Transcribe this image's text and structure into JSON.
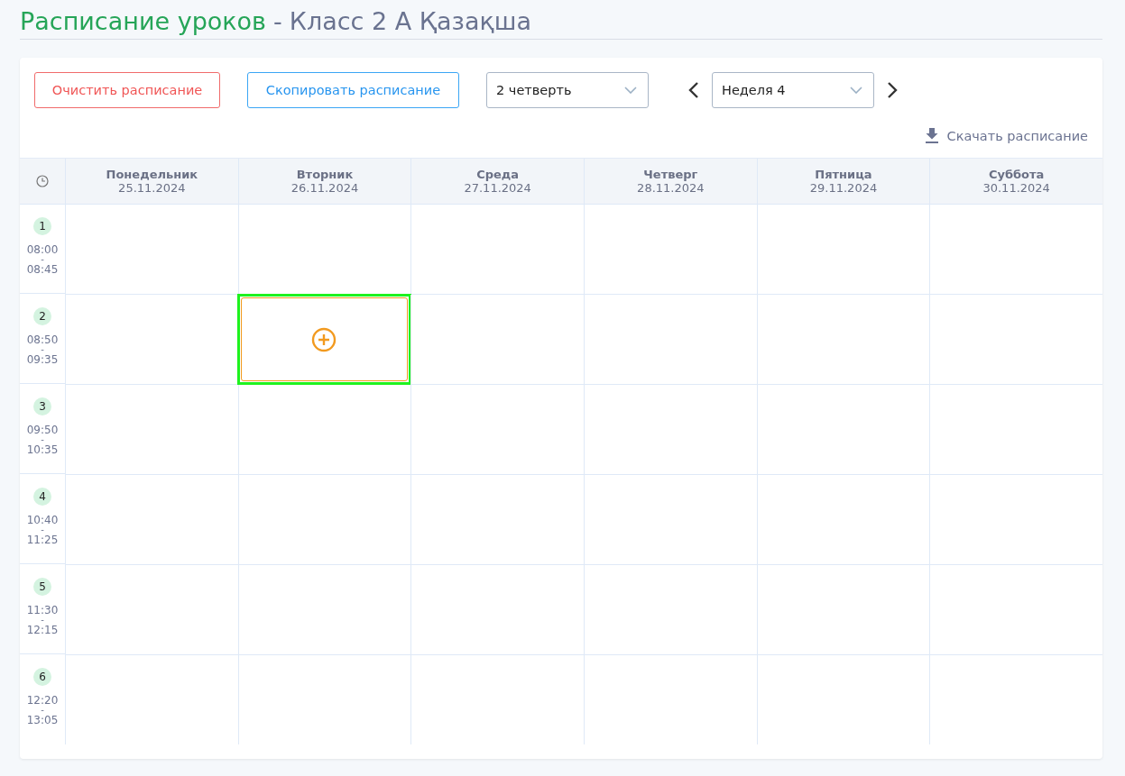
{
  "title": {
    "main": "Расписание уроков",
    "separator": "-",
    "class": "Класс 2 А Қазақша"
  },
  "toolbar": {
    "clear_button": "Очистить расписание",
    "copy_button": "Скопировать расписание",
    "quarter_select": {
      "value": "2 четверть"
    },
    "week_select": {
      "value": "Неделя 4"
    }
  },
  "download_link": "Скачать расписание",
  "days": [
    {
      "name": "Понедельник",
      "date": "25.11.2024"
    },
    {
      "name": "Вторник",
      "date": "26.11.2024"
    },
    {
      "name": "Среда",
      "date": "27.11.2024"
    },
    {
      "name": "Четверг",
      "date": "28.11.2024"
    },
    {
      "name": "Пятница",
      "date": "29.11.2024"
    },
    {
      "name": "Суббота",
      "date": "30.11.2024"
    }
  ],
  "lessons": [
    {
      "number": "1",
      "start": "08:00",
      "dash": "-",
      "end": "08:45",
      "cells": [
        {
          "kind": "empty"
        },
        {
          "kind": "empty"
        },
        {
          "kind": "empty"
        },
        {
          "kind": "empty"
        },
        {
          "kind": "empty"
        },
        {
          "kind": "empty"
        }
      ]
    },
    {
      "number": "2",
      "start": "08:50",
      "dash": "-",
      "end": "09:35",
      "cells": [
        {
          "kind": "empty"
        },
        {
          "kind": "add",
          "focused": true
        },
        {
          "kind": "empty"
        },
        {
          "kind": "empty"
        },
        {
          "kind": "empty"
        },
        {
          "kind": "empty"
        }
      ]
    },
    {
      "number": "3",
      "start": "09:50",
      "dash": "-",
      "end": "10:35",
      "cells": [
        {
          "kind": "empty"
        },
        {
          "kind": "empty"
        },
        {
          "kind": "empty"
        },
        {
          "kind": "empty"
        },
        {
          "kind": "empty"
        },
        {
          "kind": "empty"
        }
      ]
    },
    {
      "number": "4",
      "start": "10:40",
      "dash": "-",
      "end": "11:25",
      "cells": [
        {
          "kind": "empty"
        },
        {
          "kind": "empty"
        },
        {
          "kind": "empty"
        },
        {
          "kind": "empty"
        },
        {
          "kind": "empty"
        },
        {
          "kind": "empty"
        }
      ]
    },
    {
      "number": "5",
      "start": "11:30",
      "dash": "-",
      "end": "12:15",
      "cells": [
        {
          "kind": "empty"
        },
        {
          "kind": "empty"
        },
        {
          "kind": "empty"
        },
        {
          "kind": "empty"
        },
        {
          "kind": "empty"
        },
        {
          "kind": "empty"
        }
      ]
    },
    {
      "number": "6",
      "start": "12:20",
      "dash": "-",
      "end": "13:05",
      "cells": [
        {
          "kind": "empty"
        },
        {
          "kind": "empty"
        },
        {
          "kind": "empty"
        },
        {
          "kind": "empty"
        },
        {
          "kind": "empty"
        },
        {
          "kind": "empty"
        }
      ]
    }
  ]
}
